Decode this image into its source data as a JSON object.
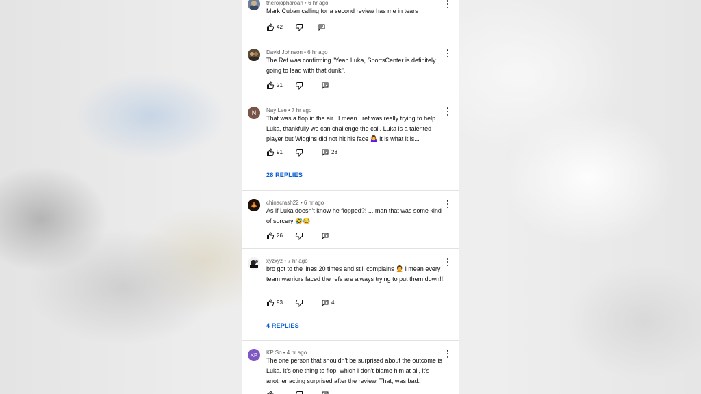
{
  "comments": [
    {
      "author": "therojopharoah",
      "time": "6 hr ago",
      "text": "Mark Cuban calling for a second review has me in tears",
      "likes": "42",
      "reply_count": "",
      "replies_link": "",
      "avatar_letter": "",
      "avatar_color": "#5b6e8c"
    },
    {
      "author": "David Johnson",
      "time": "6 hr ago",
      "text": "The Ref was confirming  \"Yeah Luka, SportsCenter is definitely going to lead with that dunk\".",
      "likes": "21",
      "reply_count": "",
      "replies_link": "",
      "avatar_letter": "",
      "avatar_color": "#4a4030"
    },
    {
      "author": "Nay Lee",
      "time": "7 hr ago",
      "text": "That was a flop in the air...I mean...ref was really trying to help Luka, thankfully we can challenge the call. Luka is a talented player but Wiggins did not hit his face 🤷‍♀️ it is what it is...",
      "likes": "91",
      "reply_count": "28",
      "replies_link": "28 REPLIES",
      "avatar_letter": "N",
      "avatar_color": "#795548"
    },
    {
      "author": "chinacrash22",
      "time": "6 hr ago",
      "text": "As if Luka doesn't know he flopped?! ... man that was some kind of sorcery 🤣😂",
      "likes": "26",
      "reply_count": "",
      "replies_link": "",
      "avatar_letter": "",
      "avatar_color": "#2b1a10"
    },
    {
      "author": "xyzxyz",
      "time": "7 hr ago",
      "text": "bro got to the lines 20 times and still complains 🤦 i mean every team warriors faced the refs are always trying to put them down!!!",
      "likes": "93",
      "reply_count": "4",
      "replies_link": "4 REPLIES",
      "avatar_letter": "",
      "avatar_color": "#f0f0f0"
    },
    {
      "author": "KP So",
      "time": "4 hr ago",
      "text": "The one person that shouldn't be surprised about the outcome is Luka.  It's one thing to flop, which I don't blame him at all, it's another acting surprised after the review.  That, was bad.",
      "likes": "",
      "reply_count": "",
      "replies_link": "",
      "avatar_letter": "KP",
      "avatar_color": "#7e57c2"
    }
  ],
  "icons": {
    "like": "thumbs-up-icon",
    "dislike": "thumbs-down-icon",
    "reply": "reply-comment-icon",
    "more": "more-vert-icon"
  },
  "colors": {
    "link": "#065fd4",
    "meta": "#606060",
    "text": "#0f0f0f"
  }
}
